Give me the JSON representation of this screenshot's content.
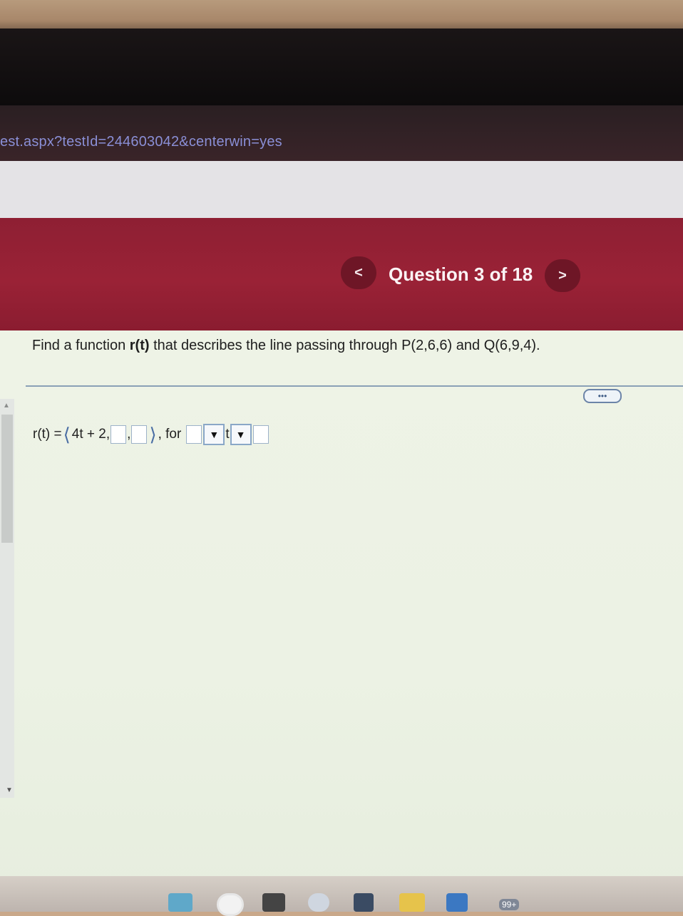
{
  "browser": {
    "url_text": "est.aspx?testId=244603042&centerwin=yes"
  },
  "header": {
    "question_label": "Question 3 of 18",
    "prev_label": "<",
    "next_label": ">"
  },
  "question": {
    "prefix": "Find a function ",
    "func_bold": "r(t)",
    "rest": " that describes the line passing through P(2,6,6) and Q(6,9,4)."
  },
  "toolbar": {
    "more_label": "•••"
  },
  "answer": {
    "lhs": "r(t) = ",
    "first_component": "4t + 2,",
    "comma1": ",",
    "comma2": ", for",
    "t_symbol": "t",
    "dropdown_arrow": "▼"
  },
  "taskbar": {
    "badge": "99+"
  },
  "colors": {
    "header_red": "#9a2236",
    "nav_button": "#6e1626",
    "content_bg": "#eef3e6",
    "url_text": "#8a8fd6"
  }
}
